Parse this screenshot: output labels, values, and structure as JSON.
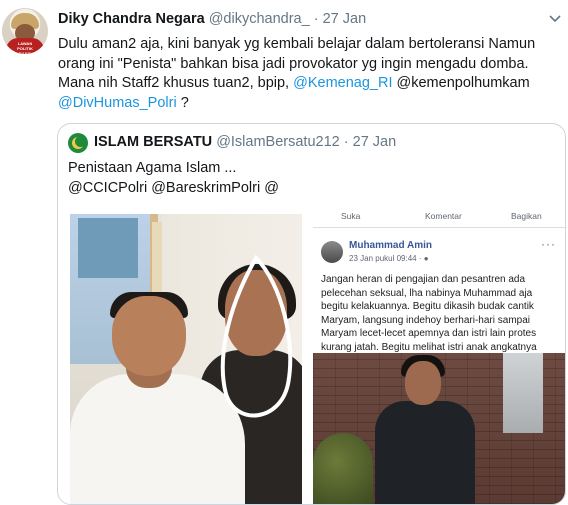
{
  "tweet": {
    "author_name": "Diky Chandra Negara",
    "author_handle": "@dikychandra_",
    "separator": "·",
    "time": "27 Jan",
    "avatar_badge": "LAWAN POLITIK RASIS",
    "text_part1": "Dulu aman2 aja, kini banyak yg kembali belajar dalam bertoleransi  Namun orang ini \"Penista\" bahkan bisa jadi provokator yg ingin mengadu domba. Mana nih Staff2 khusus tuan2, bpip, ",
    "mention1": "@Kemenag_RI",
    "text_part2": " @kemenpolhumkam ",
    "mention2": "@DivHumas_Polri",
    "text_part3": " ?"
  },
  "quoted": {
    "author_name": "ISLAM BERSATU",
    "author_handle": "@IslamBersatu212",
    "separator": "·",
    "time": "27 Jan",
    "line1": "Penistaan Agama Islam ...",
    "line2": "@CCICPolri @BareskrimPolri @"
  },
  "fb_post": {
    "action_like": "Suka",
    "action_comment": "Komentar",
    "action_share": "Bagikan",
    "author_name": "Muhammad Amin",
    "time": "23 Jan pukul 09:44 · ",
    "more": "···",
    "text": "Jangan heran di pengajian dan pesantren ada pelecehan seksual, lha nabinya Muhammad aja begitu kelakuannya. Begitu dikasih budak cantik Maryam, langsung indehoy berhari-hari sampai Maryam lecet-lecet apemnya dan istri lain protes kurang jatah. Begitu melihat istri anak angkatnya"
  },
  "icons": {
    "chevron": "chevron-down-icon",
    "globe": "globe-icon"
  },
  "colors": {
    "link": "#1b95e0",
    "muted": "#657786",
    "fb_name": "#385898",
    "border": "#ccd6dd"
  }
}
